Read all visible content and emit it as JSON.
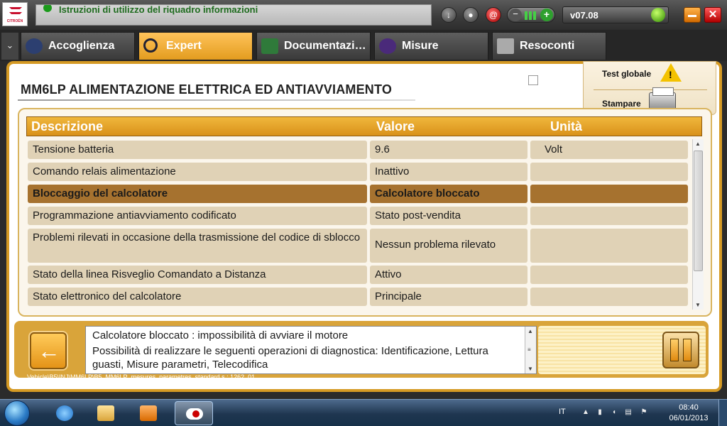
{
  "topbar": {
    "logo_text": "CITROËN",
    "info_text": "Istruzioni di utilizzo del riquadro informazioni",
    "at_symbol": "@",
    "version": "v07.08",
    "close_symbol": "✕",
    "accent_color": "#e39c1f"
  },
  "tabs": [
    {
      "label": "Accoglienza",
      "icon": "globe-icon"
    },
    {
      "label": "Expert",
      "icon": "magnifier-icon"
    },
    {
      "label": "Documentazi…",
      "icon": "book-icon"
    },
    {
      "label": "Misure",
      "icon": "waveform-icon"
    },
    {
      "label": "Resoconti",
      "icon": "report-icon"
    }
  ],
  "screen": {
    "title": "MM6LP  ALIMENTAZIONE ELETTRICA ED ANTIAVVIAMENTO",
    "side_actions": {
      "global_test": "Test globale",
      "print": "Stampare"
    }
  },
  "table": {
    "headers": {
      "description": "Descrizione",
      "value": "Valore",
      "unit": "Unità"
    },
    "rows": [
      {
        "description": "Tensione batteria",
        "value": "9.6",
        "unit": "Volt"
      },
      {
        "description": "Comando relais alimentazione",
        "value": "Inattivo",
        "unit": ""
      },
      {
        "description": "Bloccaggio del calcolatore",
        "value": "Calcolatore bloccato",
        "unit": ""
      },
      {
        "description": "Programmazione antiavviamento codificato",
        "value": "Stato post-vendita",
        "unit": ""
      },
      {
        "description": "Problemi rilevati in occasione della trasmissione del codice di sblocco",
        "value": "Nessun problema rilevato",
        "unit": ""
      },
      {
        "description": "Stato della linea Risveglio Comandato a Distanza",
        "value": "Attivo",
        "unit": ""
      },
      {
        "description": "Stato elettronico del calcolatore",
        "value": "Principale",
        "unit": ""
      }
    ]
  },
  "message": {
    "line1": "Calcolatore bloccato : impossibilità di avviare il motore",
    "line2": "Possibilità di realizzare le seguenti operazioni di diagnostica: Identificazione, Lettura",
    "line3": "guasti, Misure parametri, Telecodifica"
  },
  "path": "Vehicle\\B5\\INJ\\MM6LP\\B5_MM6LP_mesures_parametres_standard.s : 1262_01",
  "taskbar": {
    "language": "IT",
    "time": "08:40",
    "date": "06/01/2013"
  }
}
